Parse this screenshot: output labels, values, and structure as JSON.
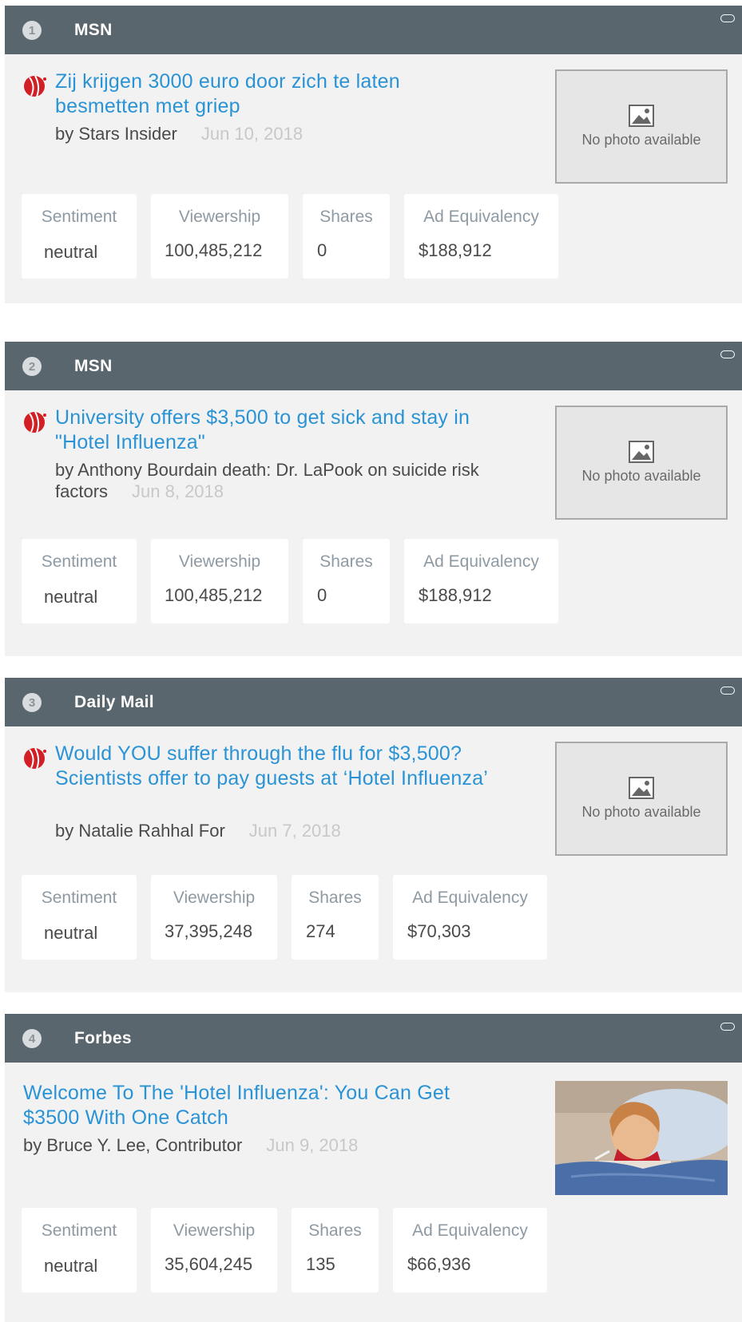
{
  "articles": [
    {
      "rank": "1",
      "source": "MSN",
      "title": "Zij krijgen 3000 euro door zich te laten besmetten met griep",
      "byline": "by Stars Insider",
      "date": "Jun 10, 2018",
      "photo": "No photo available",
      "metrics": {
        "sentiment_label": "Sentiment",
        "sentiment": "neutral",
        "viewership_label": "Viewership",
        "viewership": "100,485,212",
        "shares_label": "Shares",
        "shares": "0",
        "ad_label": "Ad Equivalency",
        "ad": "$188,912"
      }
    },
    {
      "rank": "2",
      "source": "MSN",
      "title": "University offers $3,500 to get sick and stay in \"Hotel Influenza\"",
      "byline": "by Anthony Bourdain death: Dr. LaPook on suicide risk factors",
      "date": "Jun 8, 2018",
      "photo": "No photo available",
      "metrics": {
        "sentiment_label": "Sentiment",
        "sentiment": "neutral",
        "viewership_label": "Viewership",
        "viewership": "100,485,212",
        "shares_label": "Shares",
        "shares": "0",
        "ad_label": "Ad Equivalency",
        "ad": "$188,912"
      }
    },
    {
      "rank": "3",
      "source": "Daily Mail",
      "title": "Would YOU suffer through the flu for $3,500? Scientists offer to pay guests at ‘Hotel Influenza’",
      "byline": "by Natalie Rahhal For",
      "date": "Jun 7, 2018",
      "photo": "No photo available",
      "metrics": {
        "sentiment_label": "Sentiment",
        "sentiment": "neutral",
        "viewership_label": "Viewership",
        "viewership": "37,395,248",
        "shares_label": "Shares",
        "shares": "274",
        "ad_label": "Ad Equivalency",
        "ad": "$70,303"
      }
    },
    {
      "rank": "4",
      "source": "Forbes",
      "title": "Welcome To The 'Hotel Influenza': You Can Get $3500 With One Catch",
      "byline": "by Bruce Y. Lee, Contributor",
      "date": "Jun 9, 2018",
      "metrics": {
        "sentiment_label": "Sentiment",
        "sentiment": "neutral",
        "viewership_label": "Viewership",
        "viewership": "35,604,245",
        "shares_label": "Shares",
        "shares": "135",
        "ad_label": "Ad Equivalency",
        "ad": "$66,936"
      }
    }
  ],
  "colors": {
    "header_bg": "#5a666d",
    "card_bg": "#f2f2f2",
    "link": "#2a93d5",
    "label": "#8e9aa3"
  }
}
